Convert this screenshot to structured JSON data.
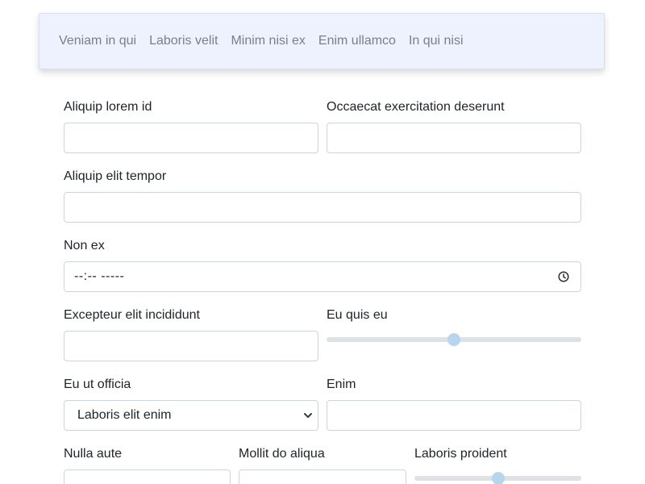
{
  "nav": {
    "items": [
      {
        "label": "Veniam in qui"
      },
      {
        "label": "Laboris velit"
      },
      {
        "label": "Minim nisi ex"
      },
      {
        "label": "Enim ullamco"
      },
      {
        "label": "In qui nisi"
      }
    ]
  },
  "form": {
    "aliquip_lorem_id": {
      "label": "Aliquip lorem id",
      "value": ""
    },
    "occaecat": {
      "label": "Occaecat exercitation deserunt",
      "value": ""
    },
    "aliquip_elit": {
      "label": "Aliquip elit tempor",
      "value": ""
    },
    "non_ex": {
      "label": "Non ex",
      "value": "--:-- -----",
      "icon": "clock-icon"
    },
    "excepteur": {
      "label": "Excepteur elit incididunt",
      "value": ""
    },
    "eu_quis_eu": {
      "label": "Eu quis eu",
      "range_fraction": 0.5
    },
    "eu_ut_officia": {
      "label": "Eu ut officia",
      "selected": "Laboris elit enim",
      "icon": "chevron-down-icon"
    },
    "enim": {
      "label": "Enim",
      "value": ""
    },
    "nulla_aute": {
      "label": "Nulla aute",
      "value": ""
    },
    "mollit": {
      "label": "Mollit do aliqua",
      "value": ""
    },
    "laboris_proident": {
      "label": "Laboris proident",
      "range_fraction": 0.5
    }
  },
  "colors": {
    "nav_background": "#eef2ff",
    "nav_link": "#7a7f87",
    "input_border": "#ced4da",
    "range_track": "#dee2e6",
    "range_thumb": "#b8d5ee"
  }
}
